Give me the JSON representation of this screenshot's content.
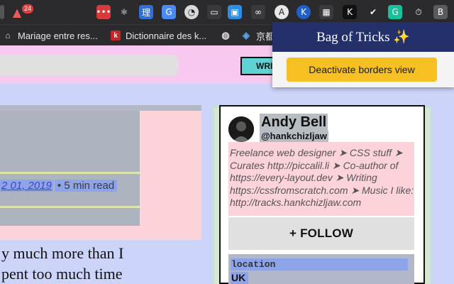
{
  "toolbar": {
    "badge_count": "24",
    "extensions": [
      {
        "name": "dots-extension",
        "glyph": "•••",
        "color": "#d63a3a"
      },
      {
        "name": "atom-extension",
        "glyph": "⚛",
        "color": "#2b2b2e"
      },
      {
        "name": "translate-extension",
        "glyph": "理",
        "color": "#2f6fd6"
      },
      {
        "name": "google-translate-extension",
        "glyph": "G",
        "color": "#4a8af4"
      },
      {
        "name": "globe-extension",
        "glyph": "◔",
        "color": "#d9d9d9"
      },
      {
        "name": "window-extension",
        "glyph": "▭",
        "color": "#3a3a3d"
      },
      {
        "name": "screen-extension",
        "glyph": "▣",
        "color": "#2d8ee6"
      },
      {
        "name": "glasses-extension",
        "glyph": "∞",
        "color": "#3a3a3d"
      },
      {
        "name": "a-extension",
        "glyph": "A",
        "color": "#e8e8e8"
      },
      {
        "name": "k-circle-extension",
        "glyph": "K",
        "color": "#2061c9"
      },
      {
        "name": "grid-extension",
        "glyph": "▦",
        "color": "#3a3a3d"
      },
      {
        "name": "k-square-extension",
        "glyph": "K",
        "color": "#111111"
      },
      {
        "name": "check-extension",
        "glyph": "✔",
        "color": "#2b2b2e"
      },
      {
        "name": "grammarly-extension",
        "glyph": "G",
        "color": "#15c39a"
      },
      {
        "name": "timer-extension",
        "glyph": "⏱",
        "color": "#2b2b2e"
      },
      {
        "name": "profile-b-extension",
        "glyph": "B",
        "color": "#5a5a5e"
      }
    ]
  },
  "bookmarks": [
    {
      "label": "Mariage entre res...",
      "icon": "house-icon"
    },
    {
      "label": "Dictionnaire des k...",
      "icon": "k-icon"
    },
    {
      "label": "",
      "icon": "globe-icon"
    },
    {
      "label": "京都",
      "icon": "cube-icon"
    }
  ],
  "page": {
    "write_label": "WRIT",
    "date": "2 01, 2019",
    "read_time": "• 5 min read",
    "body_lines": [
      "y much more than I",
      "pent too much time"
    ]
  },
  "profile": {
    "name": "Andy Bell",
    "handle": "@hankchizljaw",
    "bio": "Freelance web designer ➤ CSS stuff ➤ Curates http://piccalil.li ➤ Co-author of https://every-layout.dev ➤ Writing https://cssfromscratch.com ➤ Music I like: http://tracks.hankchizljaw.com",
    "follow_label": "+ FOLLOW",
    "location_label": "location",
    "location_value": "UK"
  },
  "popup": {
    "title": "Bag of Tricks ✨",
    "button_label": "Deactivate borders view"
  }
}
